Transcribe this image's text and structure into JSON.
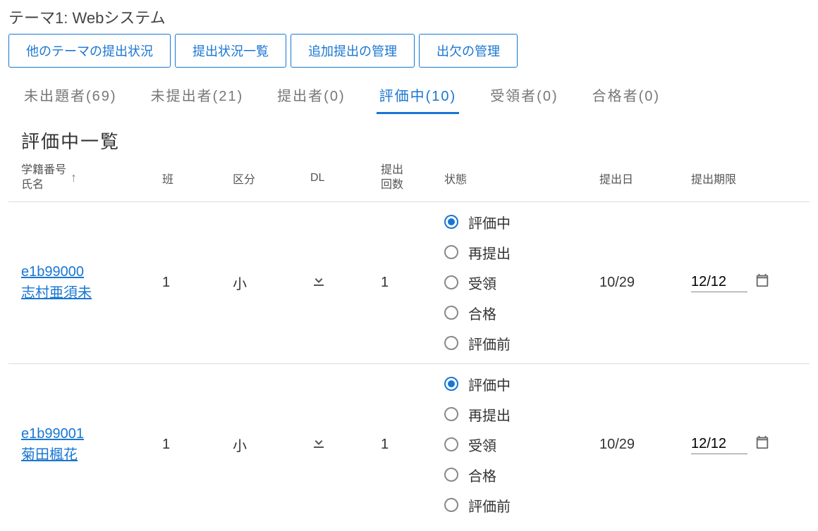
{
  "page_title": "テーマ1: Webシステム",
  "actions": [
    "他のテーマの提出状況",
    "提出状況一覧",
    "追加提出の管理",
    "出欠の管理"
  ],
  "tabs": [
    {
      "label": "未出題者(69)",
      "active": false
    },
    {
      "label": "未提出者(21)",
      "active": false
    },
    {
      "label": "提出者(0)",
      "active": false
    },
    {
      "label": "評価中(10)",
      "active": true
    },
    {
      "label": "受領者(0)",
      "active": false
    },
    {
      "label": "合格者(0)",
      "active": false
    }
  ],
  "section_title": "評価中一覧",
  "columns": {
    "student": {
      "line1": "学籍番号",
      "line2": "氏名"
    },
    "group": "班",
    "category": "区分",
    "dl": "DL",
    "count": {
      "line1": "提出",
      "line2": "回数"
    },
    "status": "状態",
    "submit_date": "提出日",
    "deadline": "提出期限"
  },
  "status_options": [
    "評価中",
    "再提出",
    "受領",
    "合格",
    "評価前"
  ],
  "rows": [
    {
      "student_id": "e1b99000",
      "student_name": "志村亜須未",
      "group": "1",
      "category": "小",
      "count": "1",
      "status_selected": 0,
      "submit_date": "10/29",
      "deadline": "12/12"
    },
    {
      "student_id": "e1b99001",
      "student_name": "菊田楓花",
      "group": "1",
      "category": "小",
      "count": "1",
      "status_selected": 0,
      "submit_date": "10/29",
      "deadline": "12/12"
    }
  ]
}
